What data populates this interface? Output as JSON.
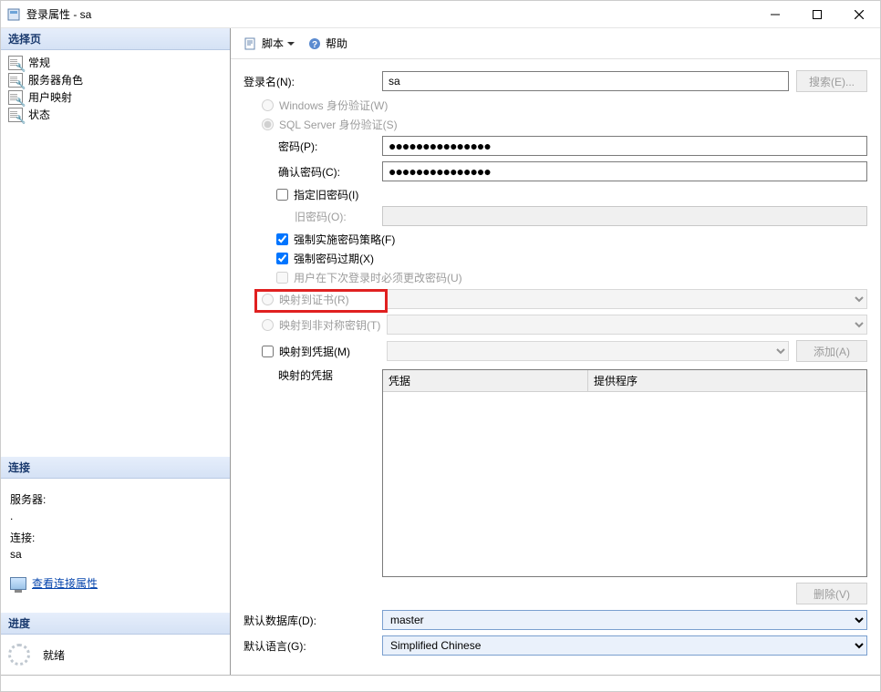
{
  "window": {
    "title": "登录属性 - sa"
  },
  "left": {
    "select_page_header": "选择页",
    "nav": [
      {
        "label": "常规"
      },
      {
        "label": "服务器角色"
      },
      {
        "label": "用户映射"
      },
      {
        "label": "状态"
      }
    ],
    "connection_header": "连接",
    "server_label": "服务器:",
    "server_value": ".",
    "conn_label": "连接:",
    "conn_value": "sa",
    "view_props": "查看连接属性",
    "progress_header": "进度",
    "progress_status": "就绪"
  },
  "toolbar": {
    "script": "脚本",
    "help": "帮助"
  },
  "form": {
    "login_name_label": "登录名(N):",
    "login_name_value": "sa",
    "search_btn": "搜索(E)...",
    "auth_windows": "Windows 身份验证(W)",
    "auth_sql": "SQL Server 身份验证(S)",
    "password_label": "密码(P):",
    "password_value": "●●●●●●●●●●●●●●●",
    "confirm_label": "确认密码(C):",
    "confirm_value": "●●●●●●●●●●●●●●●",
    "specify_old": "指定旧密码(I)",
    "old_pw_label": "旧密码(O):",
    "enforce_policy": "强制实施密码策略(F)",
    "enforce_expire": "强制密码过期(X)",
    "must_change": "用户在下次登录时必须更改密码(U)",
    "map_cert": "映射到证书(R)",
    "map_asym": "映射到非对称密钥(T)",
    "map_cred": "映射到凭据(M)",
    "add_btn": "添加(A)",
    "mapped_creds_label": "映射的凭据",
    "col_cred": "凭据",
    "col_provider": "提供程序",
    "remove_btn": "删除(V)",
    "default_db_label": "默认数据库(D):",
    "default_db_value": "master",
    "default_lang_label": "默认语言(G):",
    "default_lang_value": "Simplified Chinese"
  }
}
